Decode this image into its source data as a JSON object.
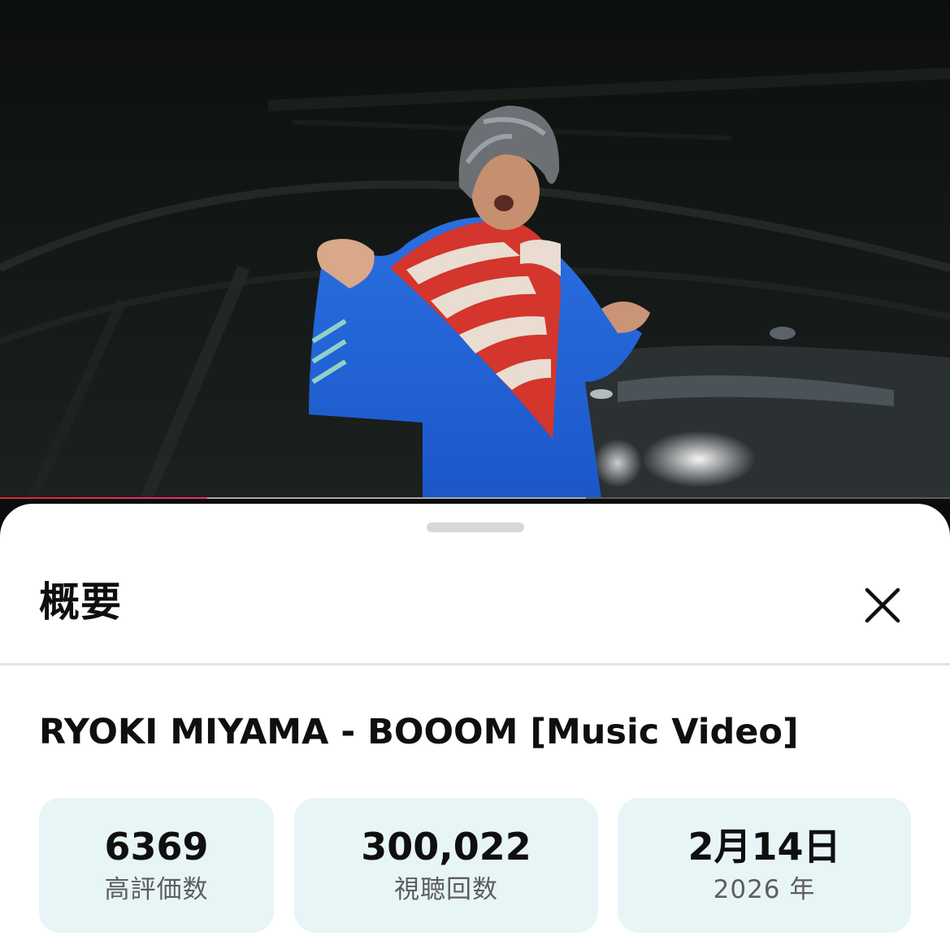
{
  "player": {
    "progress_played_fraction": 0.218,
    "progress_buffered_fraction": 0.617,
    "progress_color": "#e3262c"
  },
  "sheet": {
    "title": "概要",
    "close_icon": "close-icon"
  },
  "video": {
    "title": "RYOKI MIYAMA - BOOOM [Music Video]"
  },
  "stats": [
    {
      "value": "6369",
      "label": "高評価数"
    },
    {
      "value": "300,022",
      "label": "視聴回数"
    },
    {
      "value": "2月14日",
      "label": "2026 年"
    }
  ],
  "colors": {
    "stat_background": "#e8f5f6",
    "sheet_background": "#ffffff"
  }
}
